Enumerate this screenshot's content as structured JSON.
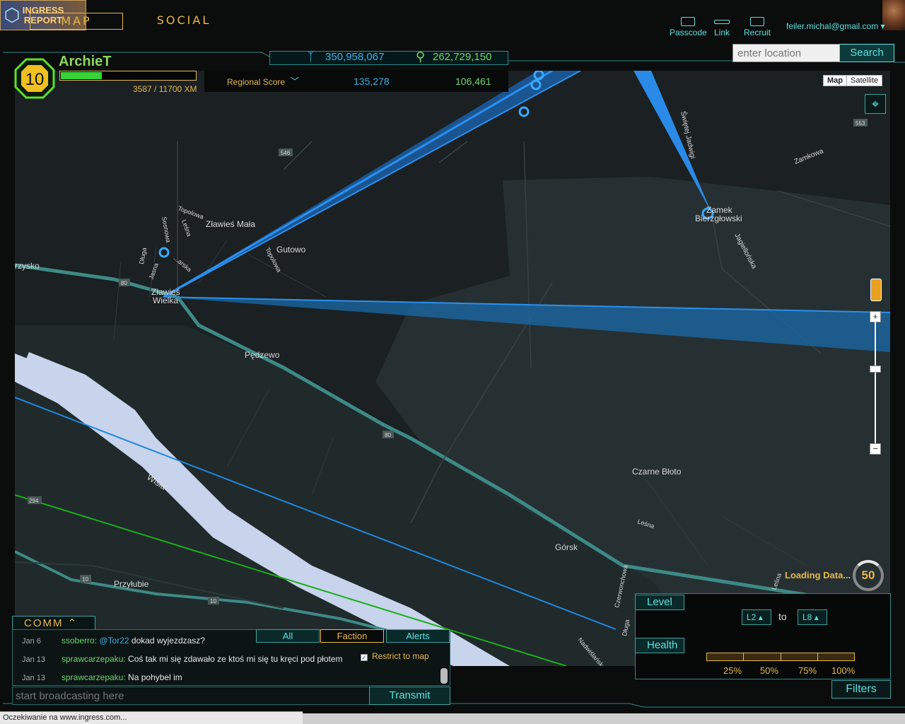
{
  "nav": {
    "map_label": "MAP",
    "social_label": "SOCIAL",
    "report_line1": "INGRESS",
    "report_line2": "REPORT"
  },
  "top_links": {
    "passcode": "Passcode",
    "link": "Link",
    "recruit": "Recruit"
  },
  "user": {
    "email": "feiler.michal@gmail.com ▾"
  },
  "search": {
    "placeholder": "enter location",
    "button": "Search"
  },
  "player": {
    "level": "10",
    "name": "ArchieT",
    "xm_text": "3587 / 11700 XM",
    "xm_fraction": 0.307
  },
  "global_score": {
    "enlightened": "350,958,067",
    "resistance": "262,729,150"
  },
  "regional": {
    "label": "Regional Score",
    "enlightened": "135,278",
    "resistance": "106,461"
  },
  "map_controls": {
    "map": "Map",
    "satellite": "Satellite",
    "loading": "Loading Data...",
    "loading_count": "50"
  },
  "map_labels": {
    "zlawies_mala": "Zławieś Mała",
    "gutowo": "Gutowo",
    "zlawies_wielka_1": "Zławieś",
    "zlawies_wielka_2": "Wielka",
    "pedzewo": "Pędzewo",
    "czarne_bloto": "Czarne Błoto",
    "gorsk": "Górsk",
    "przylubie": "Przyłubie",
    "zamek_1": "Zamek",
    "zamek_2": "Bierzgłowski",
    "wisla": "Wisła",
    "rzysko": "rzysko",
    "swietej_jadwigi": "Świętej Jadwigi",
    "zamkowa": "Zamkowa",
    "jagiellonska": "Jagiellońska",
    "topolowa": "Topolowa",
    "topolowa2": "Topolowa",
    "lesna": "Leśna",
    "lesna2": "Leśna",
    "sosnowa": "Sosnowa",
    "dluga": "Długa",
    "jasna": "Jasna",
    "mazarska": "...arska",
    "road_546": "546",
    "road_553": "553",
    "road_80a": "80",
    "road_80b": "80",
    "road_294": "294",
    "road_10a": "10",
    "road_10b": "10",
    "czerwonchowa": "Czerwonchowa",
    "nadwislanska": "Nadwiślańska",
    "dluga2": "Długa",
    "lesna3": "Leśna"
  },
  "filters": {
    "level_label": "Level",
    "level_min": "L2",
    "level_max": "L8",
    "to": "to",
    "health_label": "Health",
    "health_marks": [
      "25%",
      "50%",
      "75%",
      "100%"
    ],
    "button": "Filters"
  },
  "comm": {
    "label": "COMM",
    "tabs": [
      "All",
      "Faction",
      "Alerts"
    ],
    "restrict_label": "Restrict to map",
    "messages": [
      {
        "date": "Jan 6",
        "user": "ssoberro:",
        "mention": "@Tor22",
        "text": " dokad wyjezdzasz?"
      },
      {
        "date": "Jan 13",
        "user": "sprawcarzepaku:",
        "mention": "",
        "text": " Coś tak mi się zdawało ze ktoś mi się tu kręci pod płotem"
      },
      {
        "date": "Jan 13",
        "user": "sprawcarzepaku:",
        "mention": "",
        "text": " Na pohybel im"
      }
    ],
    "broadcast_placeholder": "start broadcasting here",
    "transmit": "Transmit"
  },
  "status_bar": "Oczekiwanie na www.ingress.com...",
  "colors": {
    "accent": "#5de0e0",
    "gold": "#e8b84a",
    "enlightened": "#3ab0e8",
    "resistance": "#6dd86d"
  }
}
